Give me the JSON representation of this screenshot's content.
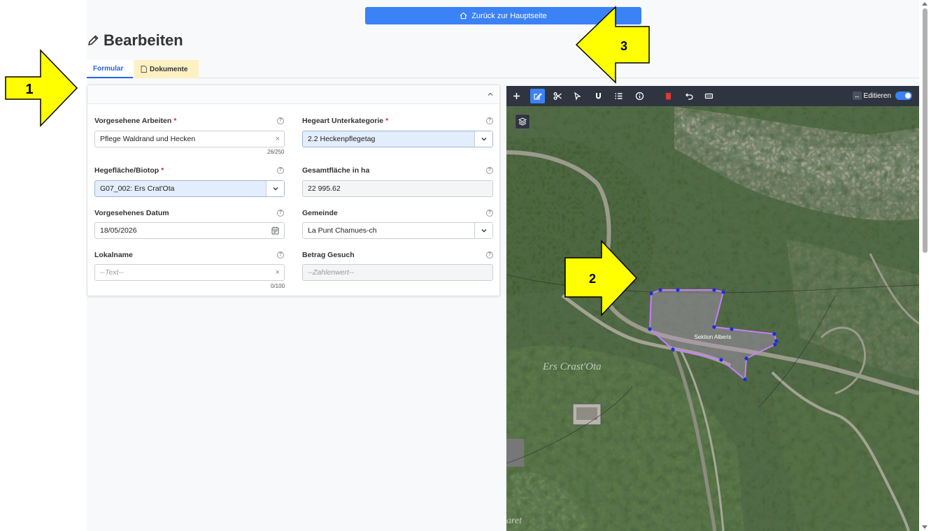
{
  "nav": {
    "home_label": "Zurück zur Hauptseite"
  },
  "page": {
    "title": "Bearbeiten"
  },
  "tabs": [
    {
      "label": "Formular"
    },
    {
      "label": "Dokumente"
    }
  ],
  "form": {
    "vorgesehene_arbeiten": {
      "label": "Vorgesehene Arbeiten",
      "value": "Pflege Waldrand und Hecken",
      "counter": "26/250"
    },
    "hegeart_unterkategorie": {
      "label": "Hegeart Unterkategorie",
      "value": "2.2 Heckenpflegetag"
    },
    "hegeflaeche": {
      "label": "Hegefläche/Biotop",
      "value": "G07_002: Ers Crat'Ota"
    },
    "gesamtflaeche": {
      "label": "Gesamtfläche in ha",
      "value": "22 995.62"
    },
    "datum": {
      "label": "Vorgesehenes Datum",
      "value": "18/05/2026"
    },
    "gemeinde": {
      "label": "Gemeinde",
      "value": "La Punt Chamues-ch"
    },
    "lokalname": {
      "label": "Lokalname",
      "placeholder": "--Text--",
      "counter": "0/100"
    },
    "betrag": {
      "label": "Betrag Gesuch",
      "placeholder": "--Zahlenwert--"
    }
  },
  "map": {
    "edit_label": "Editieren",
    "edit_enabled": true,
    "polygon_label": "Sektion Alberis",
    "place_label": "Ers Crast'Ota",
    "place_label_2": "aret",
    "active_tool": "edit-shape-icon",
    "toolbar_icons": [
      "plus-icon",
      "edit-shape-icon",
      "scissors-icon",
      "select-pointer-icon",
      "magnet-icon",
      "list-icon",
      "info-icon",
      "delete-icon",
      "undo-icon",
      "measure-icon"
    ]
  },
  "annotations": [
    {
      "label": "1"
    },
    {
      "label": "2"
    },
    {
      "label": "3"
    }
  ],
  "colors": {
    "accent": "#3b82f6",
    "required": "#dc2626",
    "dokumente_tab": "#fdf1c2",
    "callout": "#ffff00",
    "polygon_stroke": "#c77dff",
    "vertex": "#1d2be0"
  }
}
